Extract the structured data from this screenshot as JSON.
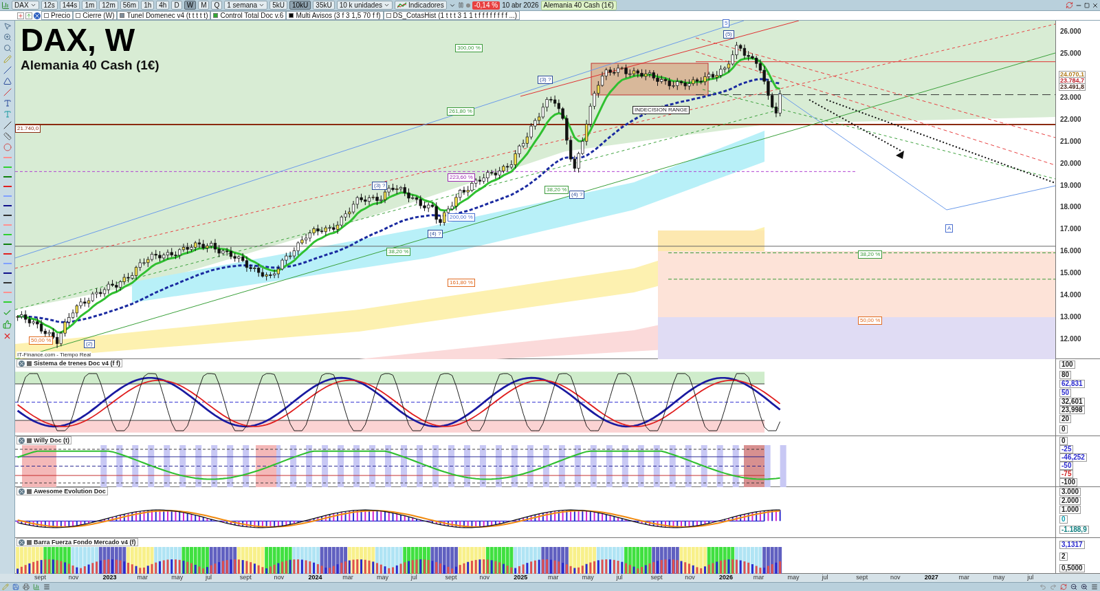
{
  "toolbar": {
    "symbol": "DAX",
    "intervals": [
      {
        "label": "12s",
        "selected": false
      },
      {
        "label": "144s",
        "selected": false
      },
      {
        "label": "1m",
        "selected": false
      },
      {
        "label": "12m",
        "selected": false
      },
      {
        "label": "56m",
        "selected": false
      },
      {
        "label": "1h",
        "selected": false
      },
      {
        "label": "4h",
        "selected": false
      },
      {
        "label": "D",
        "selected": false
      },
      {
        "label": "W",
        "selected": true
      },
      {
        "label": "M",
        "selected": false
      },
      {
        "label": "Q",
        "selected": false
      }
    ],
    "period": "1 semana",
    "units": [
      {
        "label": "5kU",
        "selected": false
      },
      {
        "label": "10kU",
        "selected": true
      },
      {
        "label": "35kU",
        "selected": false
      }
    ],
    "units_select": "10 k unidades",
    "indicators": "Indicadores",
    "change": "-0,14 %",
    "date": "10 abr 2026",
    "instrument": "Alemania 40 Cash (1€)"
  },
  "layers": [
    {
      "label": "Precio",
      "color": "#ffffff"
    },
    {
      "label": "Cierre (W)",
      "color": "#ffffff"
    },
    {
      "label": "Tunel Domenec v4 (t t t t t)",
      "color": "#7f8c99"
    },
    {
      "label": "Control Total Doc v.6",
      "color": "#33aa33"
    },
    {
      "label": "Multi Avisos (3 f 3 1,5 70 f f)",
      "color": "#000000"
    },
    {
      "label": "DS_CotasHist (1 t t t 3 1 1 t f f f f f f f f ...)",
      "color": "#ffffff"
    }
  ],
  "chart": {
    "title": "DAX, W",
    "subtitle": "Alemania 40 Cash (1€)",
    "source": "IT-Finance.com - Tiempo Real",
    "annotations": [
      {
        "text": "300,00 %",
        "color": "#3a9a3a"
      },
      {
        "text": "261,80 %",
        "color": "#3a9a3a"
      },
      {
        "text": "223,60 %",
        "color": "#9a2ab0"
      },
      {
        "text": "200,00 %",
        "color": "#4a6fd0"
      },
      {
        "text": "161,80 %",
        "color": "#e06a20"
      },
      {
        "text": "38,20 %",
        "color": "#3a9a3a"
      },
      {
        "text": "38,20 %",
        "color": "#3a9a3a"
      },
      {
        "text": "38,20 %",
        "color": "#3a9a3a"
      },
      {
        "text": "50,00 %",
        "color": "#e06a20"
      },
      {
        "text": "50,00 %",
        "color": "#e06a20"
      },
      {
        "text": "21.740,0",
        "color": "#8b2a10"
      },
      {
        "text": "INDECISION RANGE",
        "color": "#222222"
      },
      {
        "text": "(3) ?",
        "color": "#2a4a9a"
      },
      {
        "text": "(3) ?",
        "color": "#2a4a9a"
      },
      {
        "text": "(4) ?",
        "color": "#2a4a9a"
      },
      {
        "text": "(4) ?",
        "color": "#2a4a9a"
      },
      {
        "text": "(5)",
        "color": "#2a4a9a"
      },
      {
        "text": "5",
        "color": "#4a6fd0"
      },
      {
        "text": "(2)",
        "color": "#2a4a9a"
      },
      {
        "text": "A",
        "color": "#4a6fd0"
      }
    ],
    "price_axis": [
      "26.000",
      "25.000",
      "23.000",
      "22.000",
      "21.000",
      "20.000",
      "19.000",
      "18.000",
      "17.000",
      "16.000",
      "15.000",
      "14.000",
      "13.000",
      "12.000"
    ],
    "price_tags": [
      {
        "label": "24.070,1",
        "color": "#b07a1a"
      },
      {
        "label": "23.784,7",
        "color": "#c0202a"
      },
      {
        "label": "23.491,8",
        "color": "#4a2a20"
      }
    ]
  },
  "panels": [
    {
      "name": "Sistema de trenes Doc v4 (f f)",
      "axis": [
        {
          "label": "100",
          "color": "#222222"
        },
        {
          "label": "80",
          "color": "#222222"
        },
        {
          "label": "62,831",
          "color": "#2a2ad0"
        },
        {
          "label": "50",
          "color": "#2a2ad0"
        },
        {
          "label": "32,601",
          "color": "#222222"
        },
        {
          "label": "23,998",
          "color": "#222222"
        },
        {
          "label": "20",
          "color": "#222222"
        },
        {
          "label": "0",
          "color": "#222222"
        }
      ]
    },
    {
      "name": "Willy Doc (t)",
      "axis": [
        {
          "label": "0",
          "color": "#222222"
        },
        {
          "label": "-25",
          "color": "#2a2ad0"
        },
        {
          "label": "-46,252",
          "color": "#2a2ad0"
        },
        {
          "label": "-50",
          "color": "#2a2ad0"
        },
        {
          "label": "-75",
          "color": "#d02020"
        },
        {
          "label": "-100",
          "color": "#222222"
        }
      ]
    },
    {
      "name": "Awesome Evolution Doc",
      "axis": [
        {
          "label": "3.000",
          "color": "#222222"
        },
        {
          "label": "2.000",
          "color": "#222222"
        },
        {
          "label": "1.000",
          "color": "#222222"
        },
        {
          "label": "0",
          "color": "#10a0b0"
        },
        {
          "label": "-1.188,9",
          "color": "#108080"
        }
      ]
    },
    {
      "name": "Barra Fuerza Fondo Mercado v4 (f)",
      "axis": [
        {
          "label": "3,1317",
          "color": "#2a2ad0"
        },
        {
          "label": "2",
          "color": "#222222"
        },
        {
          "label": "0,5000",
          "color": "#222222"
        }
      ]
    }
  ],
  "time_axis": [
    {
      "label": "sept",
      "year": false
    },
    {
      "label": "nov",
      "year": false
    },
    {
      "label": "2023",
      "year": true
    },
    {
      "label": "mar",
      "year": false
    },
    {
      "label": "may",
      "year": false
    },
    {
      "label": "jul",
      "year": false
    },
    {
      "label": "sept",
      "year": false
    },
    {
      "label": "nov",
      "year": false
    },
    {
      "label": "2024",
      "year": true
    },
    {
      "label": "mar",
      "year": false
    },
    {
      "label": "may",
      "year": false
    },
    {
      "label": "jul",
      "year": false
    },
    {
      "label": "sept",
      "year": false
    },
    {
      "label": "nov",
      "year": false
    },
    {
      "label": "2025",
      "year": true
    },
    {
      "label": "mar",
      "year": false
    },
    {
      "label": "may",
      "year": false
    },
    {
      "label": "jul",
      "year": false
    },
    {
      "label": "sept",
      "year": false
    },
    {
      "label": "nov",
      "year": false
    },
    {
      "label": "2026",
      "year": true
    },
    {
      "label": "mar",
      "year": false
    },
    {
      "label": "may",
      "year": false
    },
    {
      "label": "jul",
      "year": false
    },
    {
      "label": "sept",
      "year": false
    },
    {
      "label": "nov",
      "year": false
    },
    {
      "label": "2027",
      "year": true
    },
    {
      "label": "mar",
      "year": false
    },
    {
      "label": "may",
      "year": false
    },
    {
      "label": "jul",
      "year": false
    }
  ]
}
